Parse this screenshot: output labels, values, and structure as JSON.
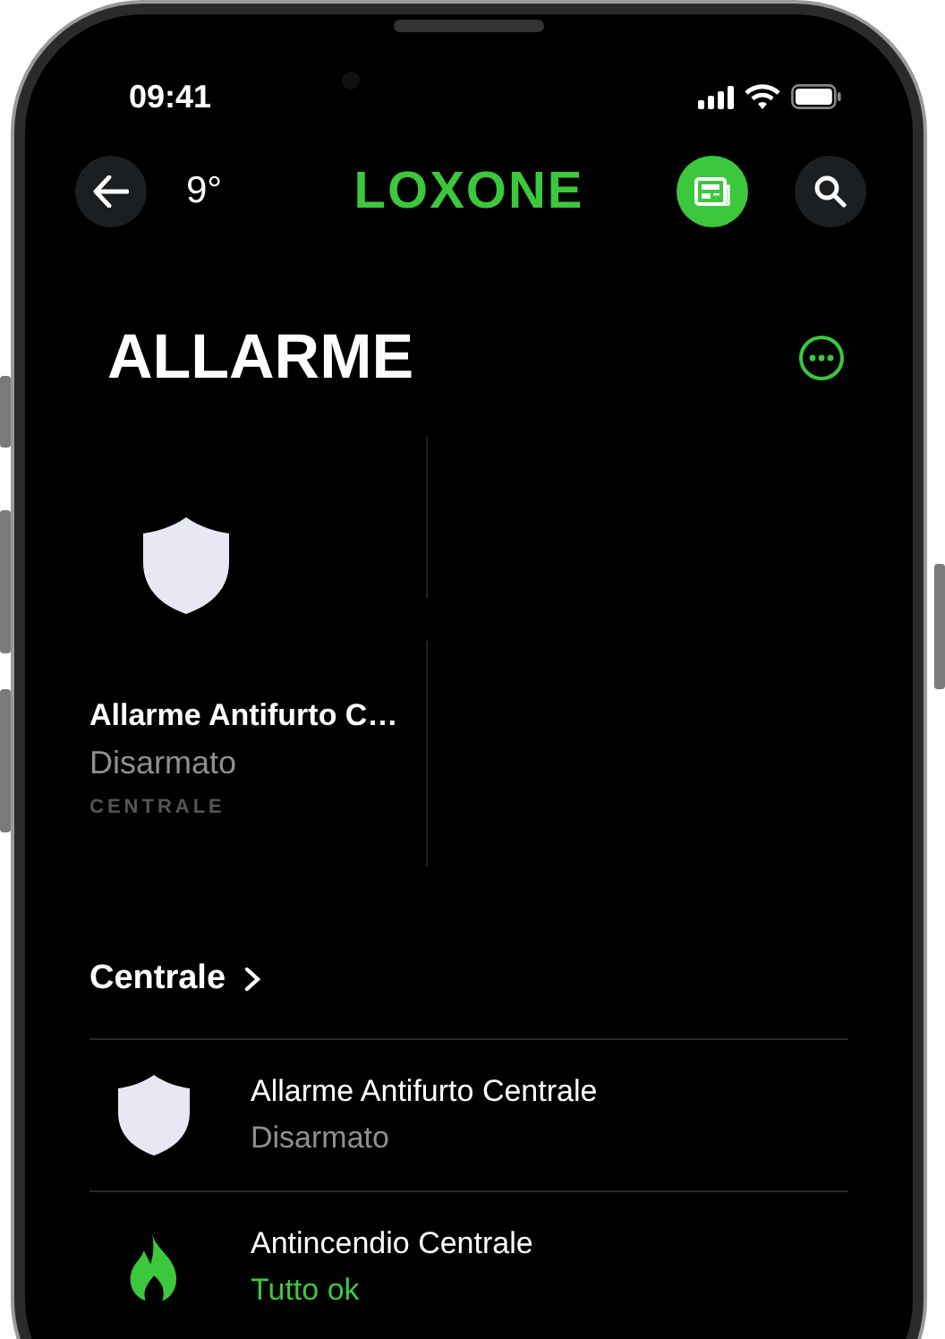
{
  "status_bar": {
    "time": "09:41"
  },
  "header": {
    "temperature": "9°",
    "logo": "LOXONE"
  },
  "page": {
    "title": "ALLARME"
  },
  "tile": {
    "name": "Allarme Antifurto C…",
    "status": "Disarmato",
    "room": "CENTRALE",
    "kind": "shield"
  },
  "section": {
    "title": "Centrale"
  },
  "rows": [
    {
      "kind": "shield",
      "name": "Allarme Antifurto Centrale",
      "status": "Disarmato",
      "color": "#8e8e93"
    },
    {
      "kind": "flame",
      "name": "Antincendio Centrale",
      "status": "Tutto ok",
      "color": "#3cc83c"
    }
  ]
}
